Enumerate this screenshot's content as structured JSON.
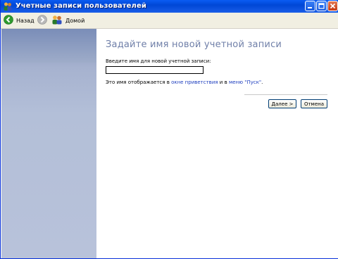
{
  "window": {
    "title": "Учетные записи пользователей",
    "controls": {
      "minimize": "minimize",
      "maximize": "maximize",
      "close": "close"
    }
  },
  "toolbar": {
    "back_label": "Назад",
    "forward_label": "",
    "home_label": "Домой"
  },
  "main": {
    "title": "Задайте имя новой учетной записи",
    "field_label": "Введите имя для новой учетной записи:",
    "field_value": "",
    "hint_prefix": "Это имя отображается в ",
    "hint_link1": "окне приветствия",
    "hint_middle": " и в ",
    "hint_link2": "меню \"Пуск\"",
    "hint_suffix": ".",
    "next_button": "Далее >",
    "cancel_button": "Отмена"
  },
  "colors": {
    "titlebar": "#0a5cf3",
    "sidebar": "#a6b2cf",
    "title_text": "#6f7fa8",
    "link": "#1f3fbf"
  },
  "icons": [
    "users-icon",
    "back-arrow-icon",
    "forward-arrow-icon",
    "home-users-icon",
    "minimize-icon",
    "maximize-icon",
    "close-icon"
  ]
}
